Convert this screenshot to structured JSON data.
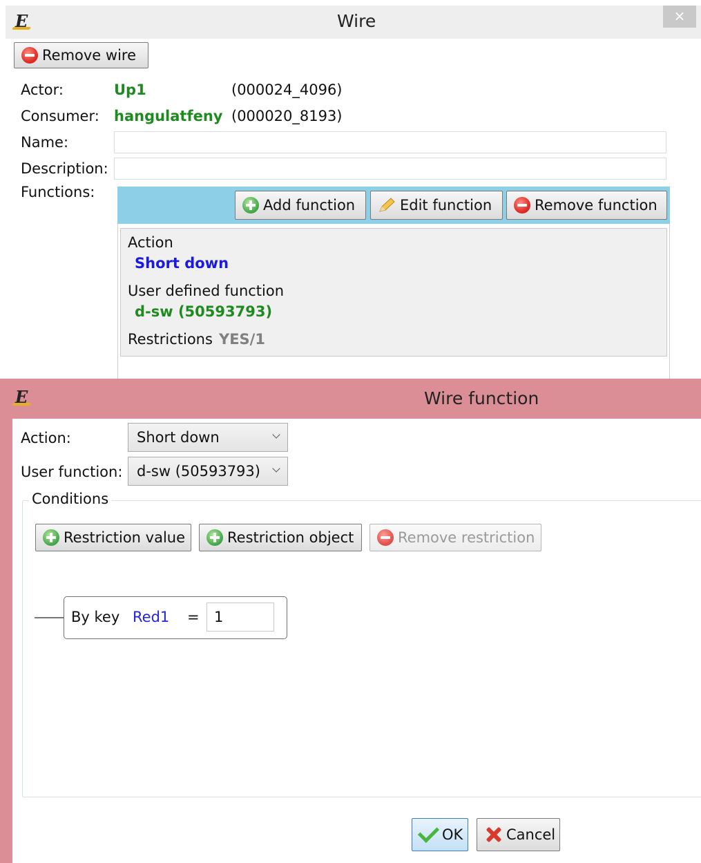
{
  "wire_window": {
    "title": "Wire",
    "close_glyph": "×",
    "remove_wire_label": "Remove wire",
    "actor_label": "Actor:",
    "actor_value": "Up1",
    "actor_id": "(000024_4096)",
    "consumer_label": "Consumer:",
    "consumer_value": "hangulatfeny",
    "consumer_id": "(000020_8193)",
    "name_label": "Name:",
    "name_value": "",
    "description_label": "Description:",
    "description_value": "",
    "functions_label": "Functions:",
    "add_function_label": "Add function",
    "edit_function_label": "Edit function",
    "remove_function_label": "Remove function",
    "function_item": {
      "action_label": "Action",
      "action_value": "Short down",
      "user_defined_label": "User defined function",
      "user_defined_value": "d-sw (50593793)",
      "restrictions_label": "Restrictions",
      "restrictions_value": "YES/1"
    }
  },
  "wire_function_window": {
    "title": "Wire function",
    "action_label": "Action:",
    "action_selected": "Short down",
    "user_function_label": "User function:",
    "user_function_selected": "d-sw (50593793)",
    "conditions_label": "Conditions",
    "restriction_value_label": "Restriction value",
    "restriction_object_label": "Restriction object",
    "remove_restriction_label": "Remove restriction",
    "rule": {
      "by_key_label": "By key",
      "key_value": "Red1",
      "operator": "=",
      "input_value": "1"
    },
    "ok_label": "OK",
    "cancel_label": "Cancel"
  },
  "colors": {
    "accent_green": "#1f8a1f",
    "accent_blue": "#1a1ae0",
    "toolbar_blue": "#8ecfe8",
    "dialog_title_pink": "#db8e96"
  }
}
